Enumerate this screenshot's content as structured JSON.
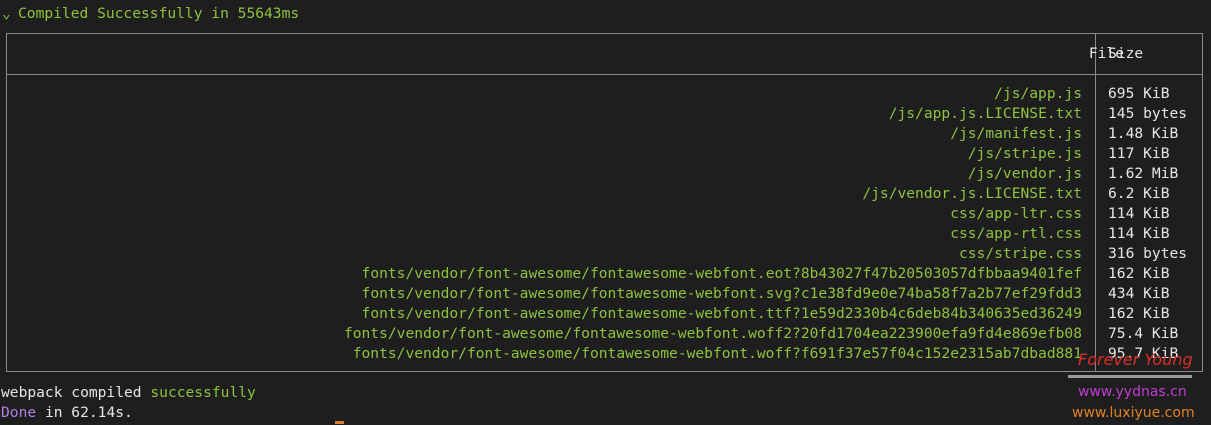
{
  "header": {
    "chevron": "⌄",
    "text": "Compiled Successfully in 55643ms"
  },
  "table": {
    "col_file": "File",
    "col_size": "Size",
    "rows": [
      {
        "file": "/js/app.js",
        "size": "695 KiB"
      },
      {
        "file": "/js/app.js.LICENSE.txt",
        "size": "145 bytes"
      },
      {
        "file": "/js/manifest.js",
        "size": "1.48 KiB"
      },
      {
        "file": "/js/stripe.js",
        "size": "117 KiB"
      },
      {
        "file": "/js/vendor.js",
        "size": "1.62 MiB"
      },
      {
        "file": "/js/vendor.js.LICENSE.txt",
        "size": "6.2 KiB"
      },
      {
        "file": "css/app-ltr.css",
        "size": "114 KiB"
      },
      {
        "file": "css/app-rtl.css",
        "size": "114 KiB"
      },
      {
        "file": "css/stripe.css",
        "size": "316 bytes"
      },
      {
        "file": "fonts/vendor/font-awesome/fontawesome-webfont.eot?8b43027f47b20503057dfbbaa9401fef",
        "size": "162 KiB"
      },
      {
        "file": "fonts/vendor/font-awesome/fontawesome-webfont.svg?c1e38fd9e0e74ba58f7a2b77ef29fdd3",
        "size": "434 KiB"
      },
      {
        "file": "fonts/vendor/font-awesome/fontawesome-webfont.ttf?1e59d2330b4c6deb84b340635ed36249",
        "size": "162 KiB"
      },
      {
        "file": "fonts/vendor/font-awesome/fontawesome-webfont.woff2?20fd1704ea223900efa9fd4e869efb08",
        "size": "75.4 KiB"
      },
      {
        "file": "fonts/vendor/font-awesome/fontawesome-webfont.woff?f691f37e57f04c152e2315ab7dbad881",
        "size": "95.7 KiB"
      }
    ]
  },
  "footer": {
    "line1_prefix": "webpack compiled ",
    "line1_status": "successfully",
    "line2_done": "Done",
    "line2_rest": " in 62.14s."
  },
  "watermark": {
    "title": "Forever Young",
    "site1": "www.yydnas.cn",
    "site2": "www.luxiyue.com"
  },
  "colors": {
    "background": "#1e1e1e",
    "success_green": "#8fc23e",
    "done_purple": "#b27fe6",
    "border": "#8a8a8a"
  }
}
